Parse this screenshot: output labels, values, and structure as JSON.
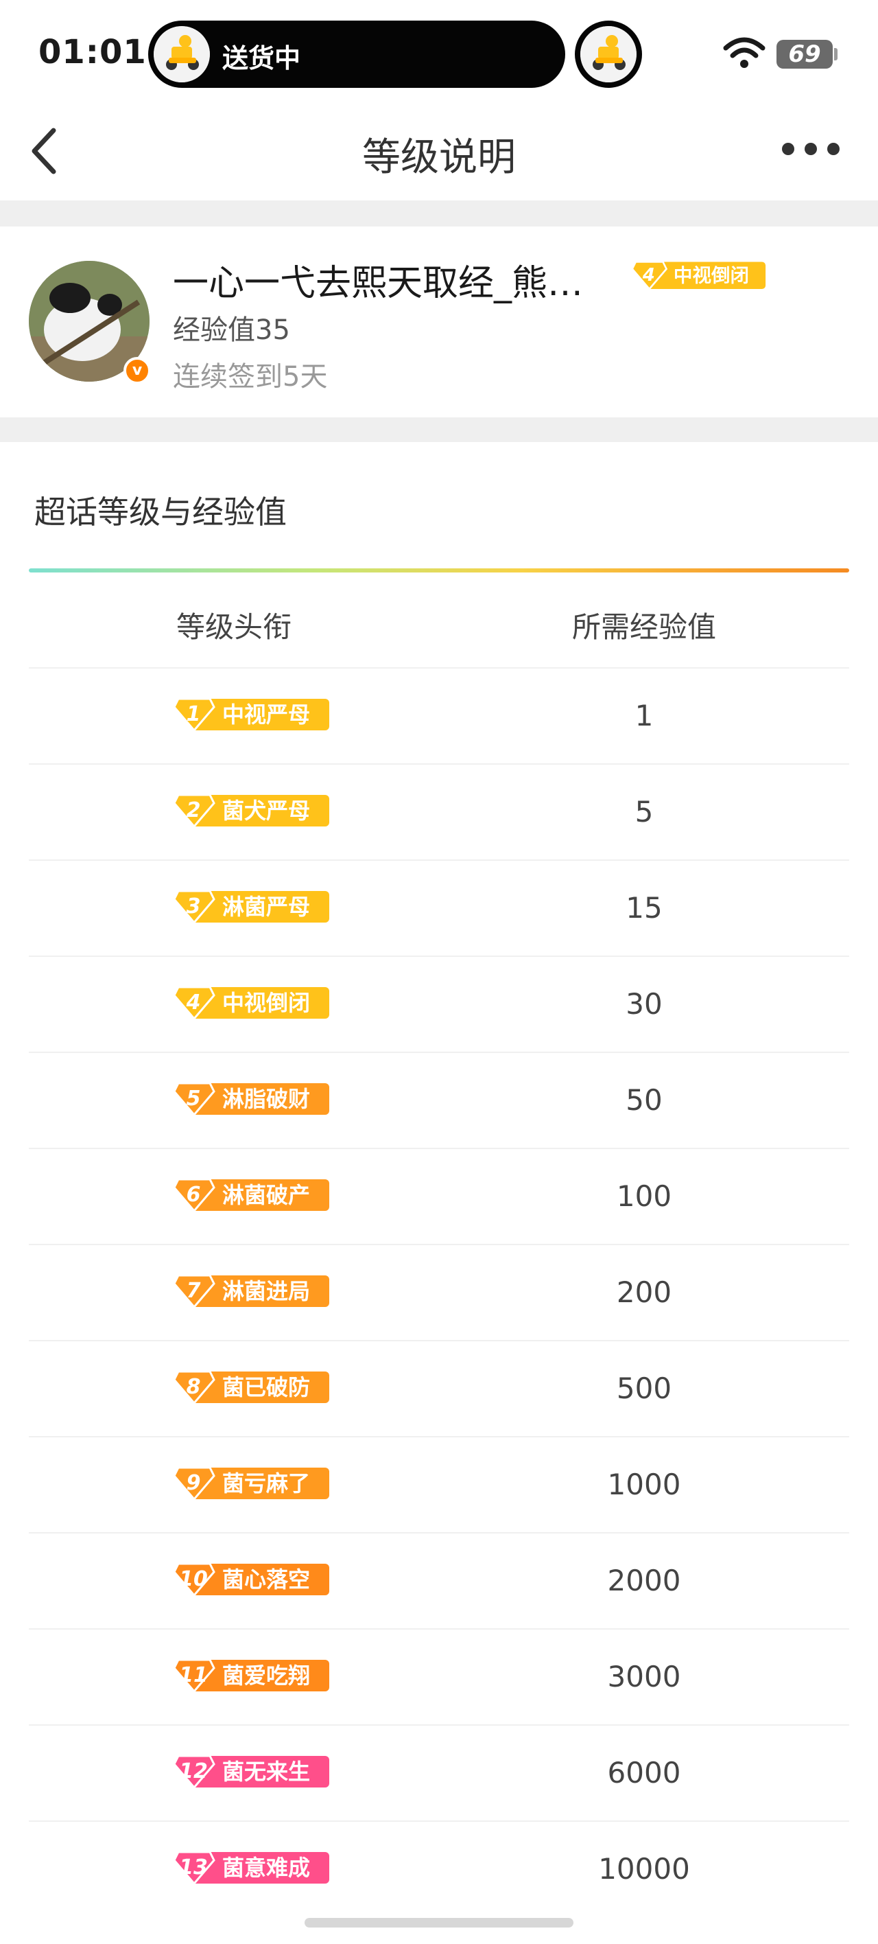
{
  "status_bar": {
    "time": "01:01",
    "live_activity_text": "送货中",
    "battery": "69"
  },
  "nav": {
    "title": "等级说明"
  },
  "profile": {
    "username": "一心一弋去熙天取经_熊…",
    "level_num": "4",
    "level_title": "中视倒闭",
    "exp": "经验值35",
    "signin": "连续签到5天"
  },
  "section": {
    "title": "超话等级与经验值",
    "col_title": "等级头衔",
    "col_exp": "所需经验值"
  },
  "levels": [
    {
      "num": "1",
      "title": "中视严母",
      "exp": "1",
      "color": "#ffc21a"
    },
    {
      "num": "2",
      "title": "菌犬严母",
      "exp": "5",
      "color": "#ffc21a"
    },
    {
      "num": "3",
      "title": "淋菌严母",
      "exp": "15",
      "color": "#ffc21a"
    },
    {
      "num": "4",
      "title": "中视倒闭",
      "exp": "30",
      "color": "#ffc21a"
    },
    {
      "num": "5",
      "title": "淋脂破财",
      "exp": "50",
      "color": "#ff9a1f"
    },
    {
      "num": "6",
      "title": "淋菌破产",
      "exp": "100",
      "color": "#ff9a1f"
    },
    {
      "num": "7",
      "title": "淋菌进局",
      "exp": "200",
      "color": "#ff9a1f"
    },
    {
      "num": "8",
      "title": "菌已破防",
      "exp": "500",
      "color": "#ff9a1f"
    },
    {
      "num": "9",
      "title": "菌亏麻了",
      "exp": "1000",
      "color": "#ff9a1f"
    },
    {
      "num": "10",
      "title": "菌心落空",
      "exp": "2000",
      "color": "#ff8a1a"
    },
    {
      "num": "11",
      "title": "菌爱吃翔",
      "exp": "3000",
      "color": "#ff8a1a"
    },
    {
      "num": "12",
      "title": "菌无来生",
      "exp": "6000",
      "color": "#ff4f8a"
    },
    {
      "num": "13",
      "title": "菌意难成",
      "exp": "10000",
      "color": "#ff4f8a"
    }
  ]
}
